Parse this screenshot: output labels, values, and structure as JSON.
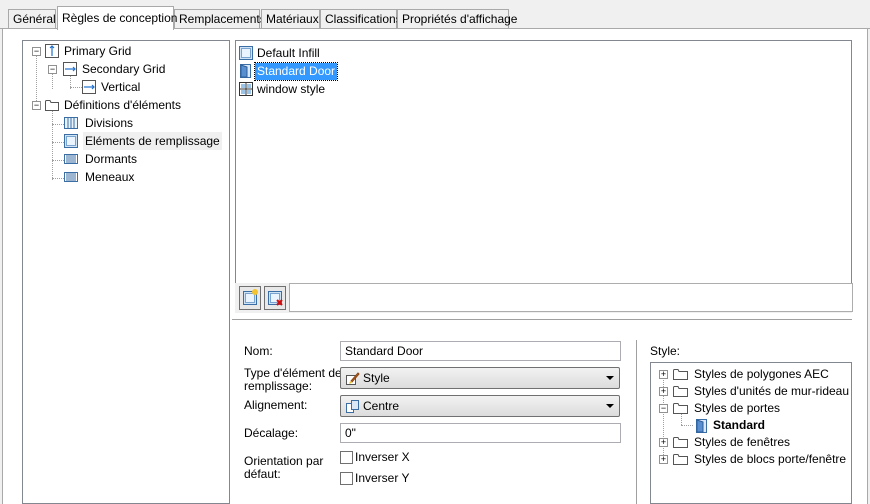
{
  "tabs": [
    {
      "label": "Général",
      "active": false
    },
    {
      "label": "Règles de conception",
      "active": true
    },
    {
      "label": "Remplacements",
      "active": false
    },
    {
      "label": "Matériaux",
      "active": false
    },
    {
      "label": "Classifications",
      "active": false
    },
    {
      "label": "Propriétés d'affichage",
      "active": false
    }
  ],
  "tree": {
    "primary_grid": "Primary Grid",
    "secondary_grid": "Secondary Grid",
    "vertical": "Vertical",
    "definitions": "Définitions d'éléments",
    "divisions": "Divisions",
    "infill": "Eléments de remplissage",
    "frames": "Dormants",
    "mullions": "Meneaux"
  },
  "list": {
    "items": [
      "Default Infill",
      "Standard Door",
      "window style"
    ],
    "selected": "Standard Door"
  },
  "toolbar": {
    "new_icon": "new-infill-icon",
    "delete_icon": "delete-infill-icon"
  },
  "form": {
    "name_label": "Nom:",
    "name_value": "Standard Door",
    "type_label_1": "Type d'élément de",
    "type_label_2": "remplissage:",
    "type_value": "Style",
    "align_label": "Alignement:",
    "align_value": "Centre",
    "offset_label": "Décalage:",
    "offset_value": "0\"",
    "orient_label_1": "Orientation par",
    "orient_label_2": "défaut:",
    "flip_x": "Inverser X",
    "flip_y": "Inverser Y",
    "flip_x_checked": false,
    "flip_y_checked": false
  },
  "style_tree": {
    "label": "Style:",
    "items": [
      "Styles de polygones AEC",
      "Styles d'unités de mur-rideau",
      "Styles de portes",
      "Standard",
      "Styles de fenêtres",
      "Styles de blocs porte/fenêtre"
    ]
  },
  "colors": {
    "selection": "#3399ff",
    "window_bg": "#f0f0f0"
  }
}
